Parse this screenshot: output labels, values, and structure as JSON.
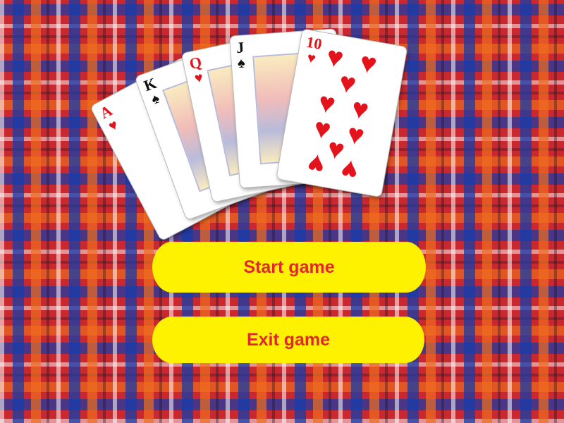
{
  "menu": {
    "start_label": "Start game",
    "exit_label": "Exit game"
  },
  "cards": [
    {
      "rank": "A",
      "suit": "♥",
      "color": "red"
    },
    {
      "rank": "K",
      "suit": "♠",
      "color": "black"
    },
    {
      "rank": "Q",
      "suit": "♥",
      "color": "red"
    },
    {
      "rank": "J",
      "suit": "♠",
      "color": "black"
    },
    {
      "rank": "10",
      "suit": "♥",
      "color": "red"
    }
  ],
  "colors": {
    "button_fill": "#fff200",
    "button_text": "#e0282e",
    "heart_red": "#e4131b"
  }
}
